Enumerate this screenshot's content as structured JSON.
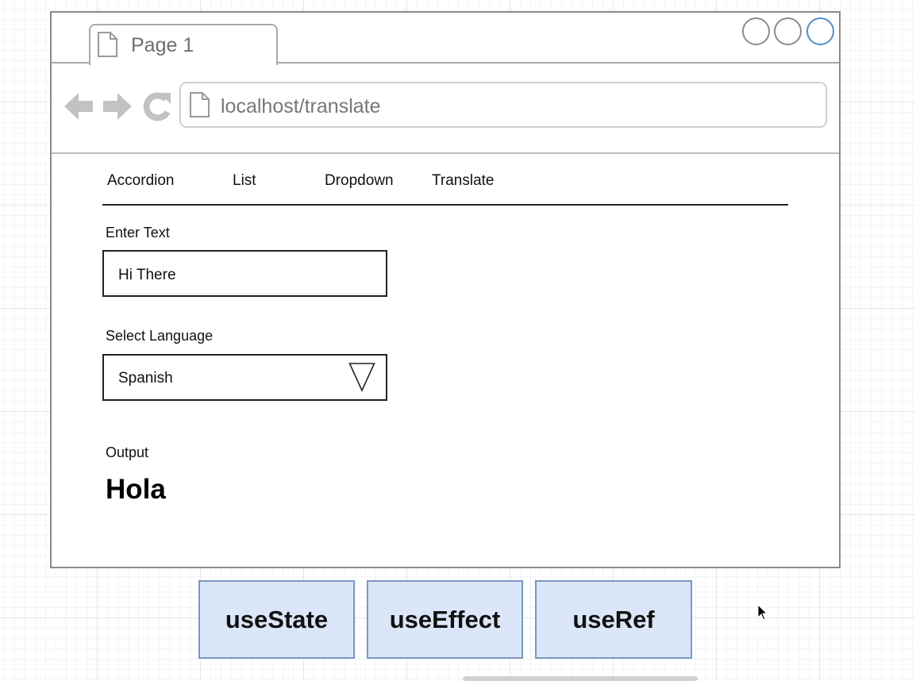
{
  "browser": {
    "tab_title": "Page 1",
    "url": "localhost/translate"
  },
  "app": {
    "nav": [
      "Accordion",
      "List",
      "Dropdown",
      "Translate"
    ],
    "enter_text_label": "Enter Text",
    "input_value": "Hi There",
    "select_language_label": "Select Language",
    "language_value": "Spanish",
    "output_label": "Output",
    "output_value": "Hola"
  },
  "hooks": [
    "useState",
    "useEffect",
    "useRef"
  ],
  "colors": {
    "hook_fill": "#dbe6f8",
    "hook_border": "#7c97c5",
    "window_button_active": "#4d8fd0"
  },
  "icons": [
    "document-icon",
    "back-arrow-icon",
    "forward-arrow-icon",
    "reload-icon",
    "dropdown-triangle-icon",
    "mouse-cursor-icon"
  ]
}
